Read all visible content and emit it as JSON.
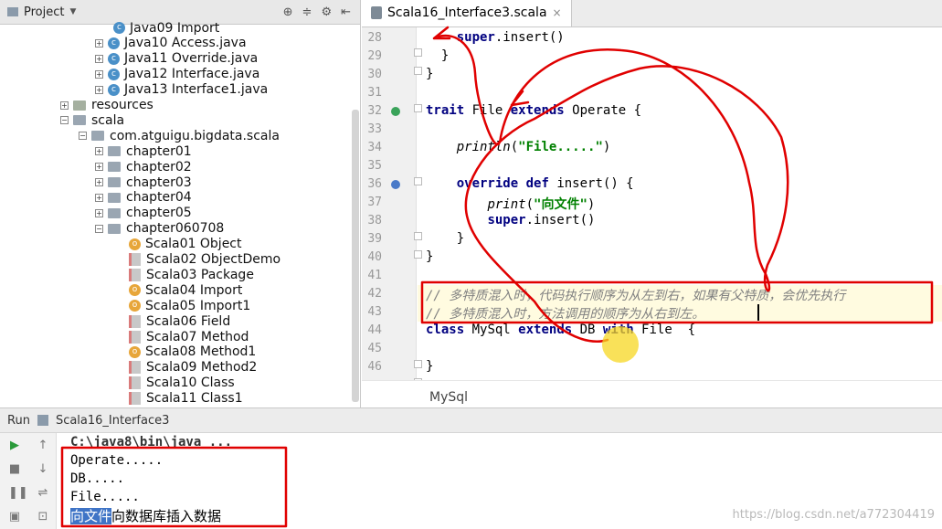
{
  "project_panel": {
    "title": "Project",
    "tree": [
      {
        "label": "Java09 Import",
        "icon": "c"
      },
      {
        "label": "Java10 Access.java",
        "icon": "c"
      },
      {
        "label": "Java11 Override.java",
        "icon": "c"
      },
      {
        "label": "Java12 Interface.java",
        "icon": "c"
      },
      {
        "label": "Java13 Interface1.java",
        "icon": "c"
      },
      {
        "label": "resources",
        "icon": "res"
      },
      {
        "label": "scala",
        "icon": "dir"
      },
      {
        "label": "com.atguigu.bigdata.scala",
        "icon": "dir"
      },
      {
        "label": "chapter01",
        "icon": "dir"
      },
      {
        "label": "chapter02",
        "icon": "dir"
      },
      {
        "label": "chapter03",
        "icon": "dir"
      },
      {
        "label": "chapter04",
        "icon": "dir"
      },
      {
        "label": "chapter05",
        "icon": "dir"
      },
      {
        "label": "chapter060708",
        "icon": "dir"
      },
      {
        "label": "Scala01 Object",
        "icon": "o"
      },
      {
        "label": "Scala02 ObjectDemo",
        "icon": "f"
      },
      {
        "label": "Scala03 Package",
        "icon": "f"
      },
      {
        "label": "Scala04 Import",
        "icon": "o"
      },
      {
        "label": "Scala05 Import1",
        "icon": "o"
      },
      {
        "label": "Scala06 Field",
        "icon": "f"
      },
      {
        "label": "Scala07 Method",
        "icon": "f"
      },
      {
        "label": "Scala08 Method1",
        "icon": "o"
      },
      {
        "label": "Scala09 Method2",
        "icon": "f"
      },
      {
        "label": "Scala10 Class",
        "icon": "f"
      },
      {
        "label": "Scala11 Class1",
        "icon": "f"
      }
    ]
  },
  "editor": {
    "tab_label": "Scala16_Interface3.scala",
    "breadcrumb": "MySql",
    "line_numbers": [
      "28",
      "29",
      "30",
      "31",
      "32",
      "33",
      "34",
      "35",
      "36",
      "37",
      "38",
      "39",
      "40",
      "41",
      "42",
      "43",
      "44",
      "45",
      "46"
    ],
    "lines": {
      "l28": [
        "super",
        ".insert()"
      ],
      "l32": [
        "trait",
        " File ",
        "extends",
        " Operate {"
      ],
      "l34": [
        "println",
        "(",
        "\"File.....\"",
        ")"
      ],
      "l36": [
        "override",
        " ",
        "def",
        " insert() {"
      ],
      "l37": [
        "print",
        "(",
        "\"向文件\"",
        ")"
      ],
      "l38": [
        "super",
        ".insert()"
      ],
      "l42": "// 多特质混入时，代码执行顺序为从左到右，如果有父特质，会优先执行",
      "l43": "// 多特质混入时，方法调用的顺序为从右到左。",
      "l44": [
        "class",
        " MySql ",
        "extends",
        " DB ",
        "with",
        " File  {"
      ]
    }
  },
  "run_panel": {
    "label": "Run",
    "config_name": "Scala16_Interface3",
    "output": {
      "cmd": "C:\\java8\\bin\\java ...",
      "line1": "Operate.....",
      "line2": "DB.....",
      "line3": "File.....",
      "line4_selected": "向文件",
      "line4_rest": "向数据库插入数据"
    }
  },
  "watermark": "https://blog.csdn.net/a772304419",
  "colors": {
    "keyword": "#000080",
    "string": "#008000",
    "comment": "#808080",
    "annotation": "#e00000",
    "selection": "#3f74c6"
  }
}
